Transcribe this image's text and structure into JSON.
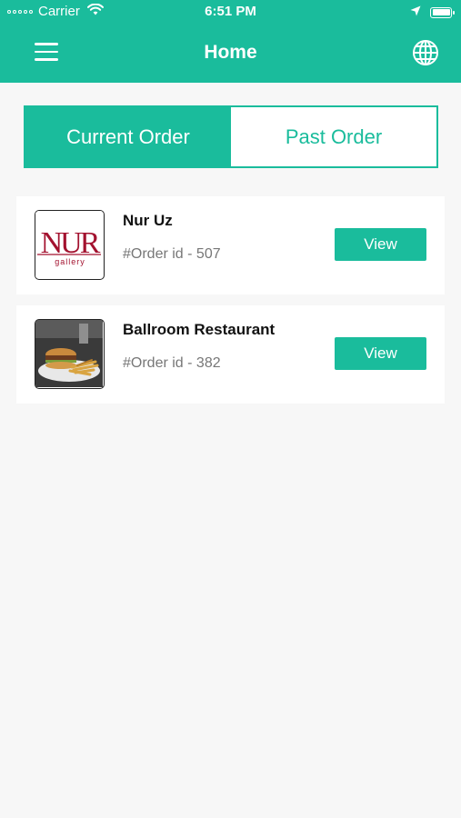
{
  "status_bar": {
    "carrier": "Carrier",
    "time": "6:51 PM"
  },
  "header": {
    "title": "Home",
    "menu_icon": "hamburger-menu-icon",
    "globe_icon": "globe-icon",
    "background_color": "#1abc9c"
  },
  "tabs": {
    "current": "Current Order",
    "past": "Past Order",
    "active": "current"
  },
  "orders": [
    {
      "name": "Nur Uz",
      "order_id": "#Order id - 507",
      "view_label": "View",
      "logo_text": "NUR",
      "logo_subtext": "gallery"
    },
    {
      "name": "Ballroom Restaurant",
      "order_id": "#Order id - 382",
      "view_label": "View"
    }
  ],
  "colors": {
    "accent": "#1abc9c",
    "background": "#f7f7f7",
    "logo_red": "#a3122f"
  }
}
